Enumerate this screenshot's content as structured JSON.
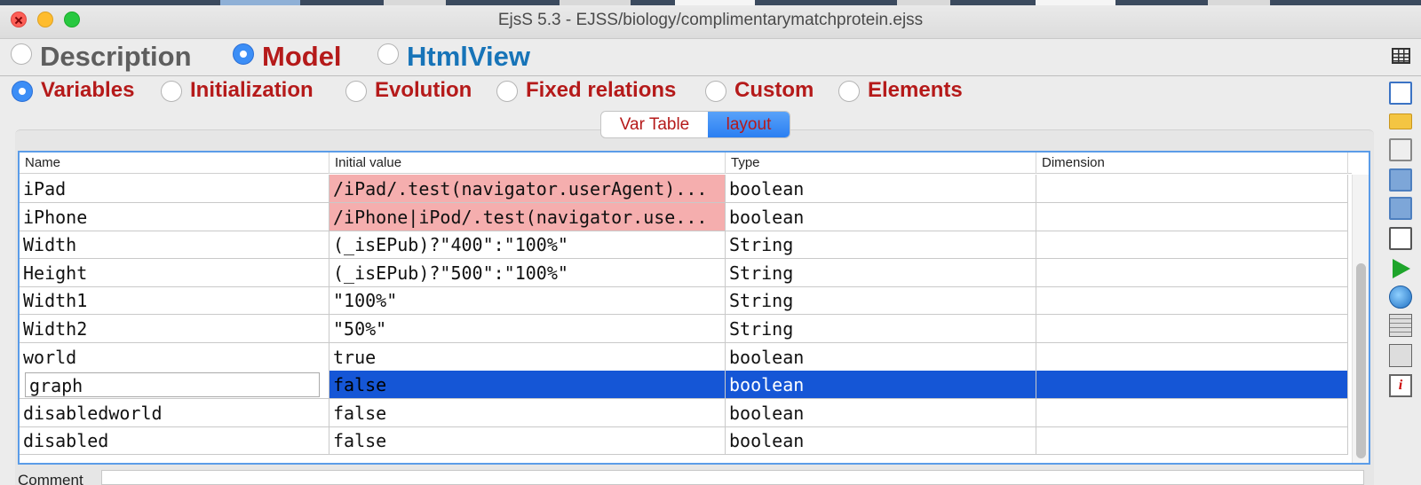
{
  "window": {
    "title": "EjsS 5.3 - EJSS/biology/complimentarymatchprotein.ejss"
  },
  "modes": [
    {
      "label": "Description",
      "selected": false
    },
    {
      "label": "Model",
      "selected": true
    },
    {
      "label": "HtmlView",
      "selected": false
    }
  ],
  "subtabs": [
    {
      "label": "Variables",
      "selected": true
    },
    {
      "label": "Initialization",
      "selected": false
    },
    {
      "label": "Evolution",
      "selected": false
    },
    {
      "label": "Fixed relations",
      "selected": false
    },
    {
      "label": "Custom",
      "selected": false
    },
    {
      "label": "Elements",
      "selected": false
    }
  ],
  "view_toggle": {
    "var_table": "Var Table",
    "layout": "layout",
    "active": "layout"
  },
  "table": {
    "columns": [
      "Name",
      "Initial value",
      "Type",
      "Dimension"
    ],
    "rows": [
      {
        "name": "iPad",
        "value": "/iPad/.test(navigator.userAgent)...",
        "type": "boolean",
        "dimension": "",
        "error": true
      },
      {
        "name": "iPhone",
        "value": "/iPhone|iPod/.test(navigator.use...",
        "type": "boolean",
        "dimension": "",
        "error": true
      },
      {
        "name": "Width",
        "value": "(_isEPub)?\"400\":\"100%\"",
        "type": "String",
        "dimension": ""
      },
      {
        "name": "Height",
        "value": "(_isEPub)?\"500\":\"100%\"",
        "type": "String",
        "dimension": ""
      },
      {
        "name": "Width1",
        "value": "\"100%\"",
        "type": "String",
        "dimension": ""
      },
      {
        "name": "Width2",
        "value": "\"50%\"",
        "type": "String",
        "dimension": ""
      },
      {
        "name": "world",
        "value": "true",
        "type": "boolean",
        "dimension": ""
      },
      {
        "name": "graph",
        "value": "false",
        "type": "boolean",
        "dimension": "",
        "selected": true
      },
      {
        "name": "disabledworld",
        "value": "false",
        "type": "boolean",
        "dimension": ""
      },
      {
        "name": "disabled",
        "value": "false",
        "type": "boolean",
        "dimension": ""
      }
    ]
  },
  "comment": {
    "label": "Comment",
    "value": ""
  },
  "toolbar_icons": [
    "new-file-icon",
    "open-folder-icon",
    "open-network-icon",
    "save-icon",
    "save-as-icon",
    "search-icon",
    "run-icon",
    "web-icon",
    "package-icon",
    "options-icon",
    "info-icon"
  ],
  "colors": {
    "accent": "#3c8ef6",
    "label_red": "#b51a1a",
    "htmlview_blue": "#1774b8",
    "error_cell": "#f5aeae",
    "selection": "#1556d6"
  }
}
